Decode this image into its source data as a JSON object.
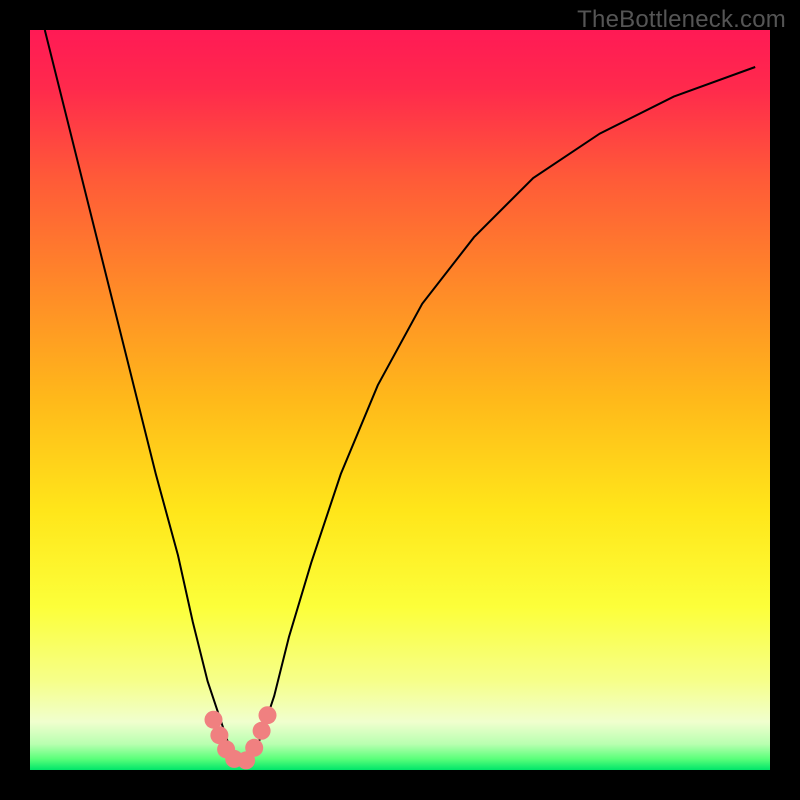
{
  "watermark": {
    "text": "TheBottleneck.com"
  },
  "chart_data": {
    "type": "line",
    "title": "",
    "xlabel": "",
    "ylabel": "",
    "xlim": [
      0,
      100
    ],
    "ylim": [
      0,
      100
    ],
    "grid": false,
    "background": {
      "type": "vertical-gradient",
      "stops": [
        {
          "offset": 0.0,
          "color": "#ff1a55"
        },
        {
          "offset": 0.08,
          "color": "#ff2a4c"
        },
        {
          "offset": 0.2,
          "color": "#ff5a38"
        },
        {
          "offset": 0.35,
          "color": "#ff8a28"
        },
        {
          "offset": 0.5,
          "color": "#ffb91a"
        },
        {
          "offset": 0.65,
          "color": "#ffe61a"
        },
        {
          "offset": 0.78,
          "color": "#fcff3a"
        },
        {
          "offset": 0.88,
          "color": "#f6ff8a"
        },
        {
          "offset": 0.935,
          "color": "#f0ffce"
        },
        {
          "offset": 0.965,
          "color": "#b8ffb0"
        },
        {
          "offset": 0.985,
          "color": "#5aff7a"
        },
        {
          "offset": 1.0,
          "color": "#00e56a"
        }
      ]
    },
    "series": [
      {
        "name": "curve",
        "x": [
          2,
          5,
          8,
          11,
          14,
          17,
          20,
          22,
          24,
          26,
          27,
          28,
          29,
          30,
          31,
          33,
          35,
          38,
          42,
          47,
          53,
          60,
          68,
          77,
          87,
          98
        ],
        "y": [
          100,
          88,
          76,
          64,
          52,
          40,
          29,
          20,
          12,
          6,
          3,
          1,
          1,
          2,
          4,
          10,
          18,
          28,
          40,
          52,
          63,
          72,
          80,
          86,
          91,
          95
        ],
        "stroke": "#000000",
        "stroke_width": 2
      }
    ],
    "markers": {
      "name": "valley-dots",
      "color": "#f08080",
      "radius": 9,
      "points": [
        {
          "x": 24.8,
          "y": 6.8
        },
        {
          "x": 25.6,
          "y": 4.7
        },
        {
          "x": 26.5,
          "y": 2.8
        },
        {
          "x": 27.6,
          "y": 1.5
        },
        {
          "x": 29.2,
          "y": 1.3
        },
        {
          "x": 30.3,
          "y": 3.0
        },
        {
          "x": 31.3,
          "y": 5.3
        },
        {
          "x": 32.1,
          "y": 7.4
        }
      ]
    }
  }
}
